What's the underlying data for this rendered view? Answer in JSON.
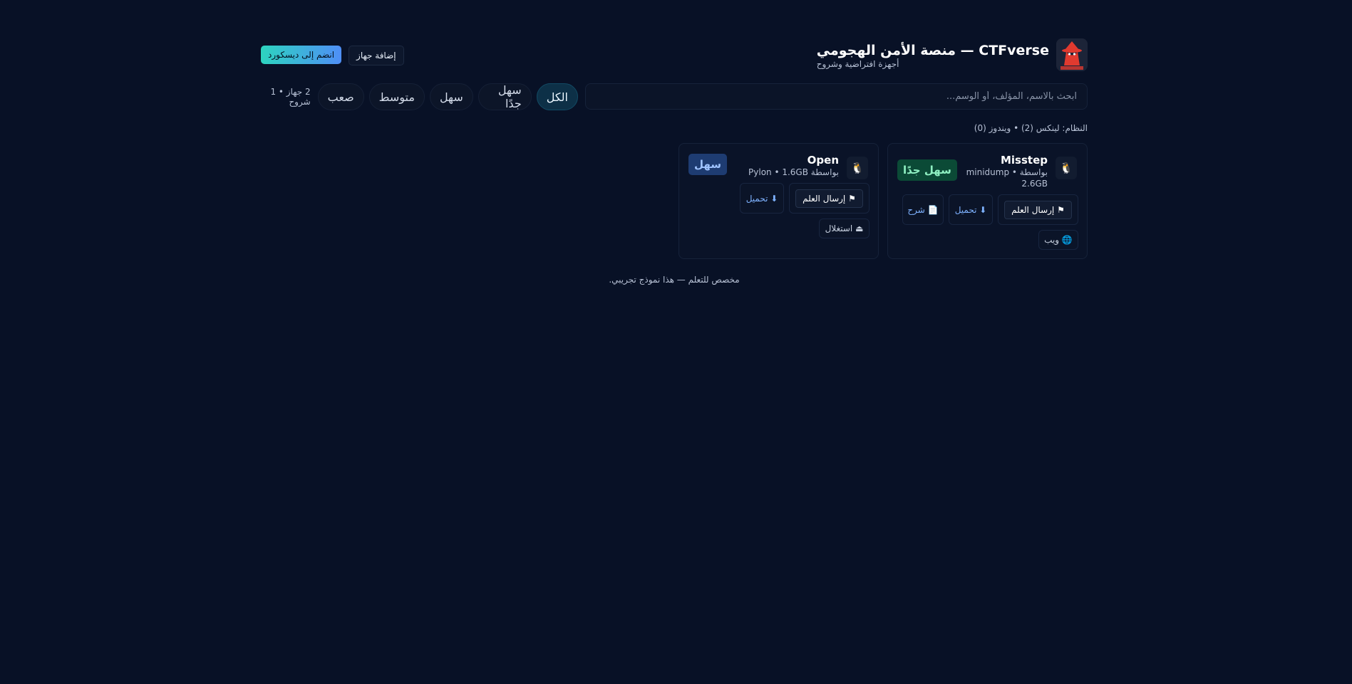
{
  "header": {
    "title": "CTFverse — منصة الأمن الهجومي",
    "subtitle": "أجهزة افتراضية وشروح",
    "logo_text": "CTFVERSE",
    "discord_button": "انضم إلى ديسكورد",
    "add_machine_button": "إضافة جهاز"
  },
  "search": {
    "placeholder": "ابحث بالاسم، المؤلف، أو الوسم..."
  },
  "filters": {
    "all": "الكل",
    "very_easy": "سهل جدًا",
    "easy": "سهل",
    "medium": "متوسط",
    "hard": "صعب",
    "counts": "2 جهاز • 1 شروح"
  },
  "system_summary": "النظام: لينكس (2) • ويندوز (0)",
  "machines": [
    {
      "name": "Misstep",
      "meta": "بواسطة minidump • 2.6GB",
      "difficulty": "سهل جدًا",
      "os_icon": "linux-penguin-icon",
      "submit_flag": "⚑ إرسال العلم",
      "download": "⬇ تحميل",
      "writeup": "📄 شرح",
      "tag": "🌐 ويب"
    },
    {
      "name": "Open",
      "meta": "بواسطة Pylon • 1.6GB",
      "difficulty": "سهل",
      "os_icon": "linux-penguin-icon",
      "submit_flag": "⚑ إرسال العلم",
      "download": "⬇ تحميل",
      "tag": "⏏ استغلال"
    }
  ],
  "footer": "مخصص للتعلم — هذا نموذج تجريبي.",
  "colors": {
    "background": "#081126",
    "accent_gradient_start": "#2dd4bf",
    "accent_gradient_end": "#4f8ff7",
    "very_easy_badge": "#0b4a36",
    "easy_badge": "#1e3c72"
  }
}
